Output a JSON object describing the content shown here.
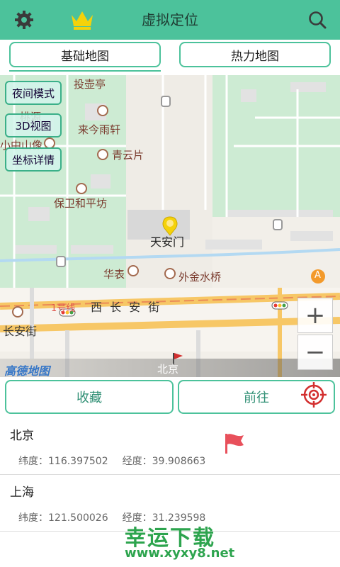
{
  "appbar": {
    "title": "虚拟定位",
    "accent": "#4cc29b"
  },
  "tabs": [
    {
      "label": "基础地图",
      "selected": true
    },
    {
      "label": "热力地图",
      "selected": false
    }
  ],
  "map": {
    "buttons": [
      "夜间模式",
      "3D视图",
      "坐标详情"
    ],
    "zoom_in": "+",
    "zoom_out": "−",
    "logo": "高德地图",
    "area_label": "北京",
    "labels": {
      "touhu": "投壶亭",
      "taoyuan": "桃源",
      "xiaozhongshan": "小中山像",
      "laijinyu": "来今雨轩",
      "qingyunpian": "青云片",
      "baowei": "保卫和平坊",
      "tiananmen": "天安门",
      "huabiao": "华表",
      "waijin": "外金水桥",
      "line1": "1号线",
      "xichangan": "西 长 安 街",
      "changan": "长安街",
      "metro_a": "A"
    }
  },
  "actions": {
    "favorite": "收藏",
    "go": "前往"
  },
  "locations": [
    {
      "name": "北京",
      "lng_label": "纬度：",
      "lng": "116.397502",
      "lat_label": "经度：",
      "lat": "39.908663"
    },
    {
      "name": "上海",
      "lng_label": "纬度：",
      "lng": "121.500026",
      "lat_label": "经度：",
      "lat": "31.239598"
    }
  ],
  "watermark": {
    "title": "幸运下载",
    "url": "www.xyxy8.net"
  },
  "icons": [
    "gear-icon",
    "crown-icon",
    "search-icon",
    "pin-icon",
    "target-icon",
    "flag-icon"
  ]
}
